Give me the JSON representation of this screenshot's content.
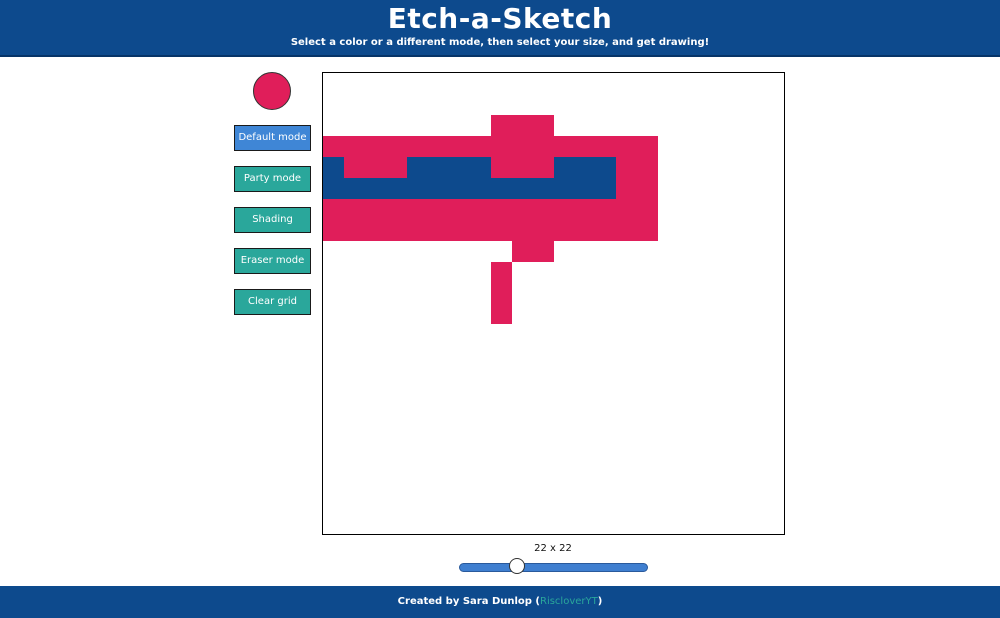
{
  "header": {
    "title": "Etch-a-Sketch",
    "subtitle": "Select a color or a different mode, then select your size, and get drawing!"
  },
  "color_picker": {
    "value": "#e01e5a"
  },
  "colors": {
    "header_bg": "#0d4a8d",
    "button_active": "#3f86d6",
    "button_default": "#2aa79b",
    "paint_pink": "#e01e5a",
    "paint_blue": "#0d4a8d",
    "link": "#2aa79b"
  },
  "buttons": [
    {
      "id": "default",
      "label": "Default mode",
      "active": true
    },
    {
      "id": "party",
      "label": "Party mode",
      "active": false
    },
    {
      "id": "shading",
      "label": "Shading",
      "active": false
    },
    {
      "id": "eraser",
      "label": "Eraser mode",
      "active": false
    },
    {
      "id": "clear",
      "label": "Clear grid",
      "active": false
    }
  ],
  "grid": {
    "size": 22,
    "filled": [
      {
        "row": 2,
        "cols": [
          8,
          9,
          10
        ],
        "color": "pink"
      },
      {
        "row": 3,
        "cols": [
          0,
          1,
          2,
          3,
          4,
          5,
          6,
          7,
          8,
          9,
          10,
          11,
          12,
          13,
          14,
          15
        ],
        "color": "pink"
      },
      {
        "row": 4,
        "cols": [
          1,
          2,
          3,
          8,
          9,
          10,
          14,
          15
        ],
        "color": "pink"
      },
      {
        "row": 4,
        "cols": [
          0,
          4,
          5,
          6,
          7,
          11,
          12,
          13
        ],
        "color": "blue"
      },
      {
        "row": 5,
        "cols": [
          14,
          15
        ],
        "color": "pink"
      },
      {
        "row": 5,
        "cols": [
          0,
          1,
          2,
          3,
          4,
          5,
          6,
          7,
          8,
          9,
          10,
          11,
          12,
          13
        ],
        "color": "blue"
      },
      {
        "row": 6,
        "cols": [
          0,
          1,
          2,
          3,
          4,
          5,
          6,
          7,
          8,
          9,
          10,
          11,
          12,
          13,
          14,
          15
        ],
        "color": "pink"
      },
      {
        "row": 7,
        "cols": [
          0,
          1,
          2,
          3,
          4,
          5,
          6,
          7,
          8,
          9,
          10,
          11,
          12,
          13,
          14,
          15
        ],
        "color": "pink"
      },
      {
        "row": 8,
        "cols": [
          9,
          10
        ],
        "color": "pink"
      },
      {
        "row": 9,
        "cols": [
          8
        ],
        "color": "pink"
      },
      {
        "row": 10,
        "cols": [
          8
        ],
        "color": "pink"
      },
      {
        "row": 11,
        "cols": [
          8
        ],
        "color": "pink"
      }
    ]
  },
  "size_label": "22 x 22",
  "slider": {
    "value": 22,
    "min": 16,
    "max": 100
  },
  "footer": {
    "prefix": "Created by Sara Dunlop (",
    "link_text": "RiscloverYT",
    "suffix": ")"
  }
}
